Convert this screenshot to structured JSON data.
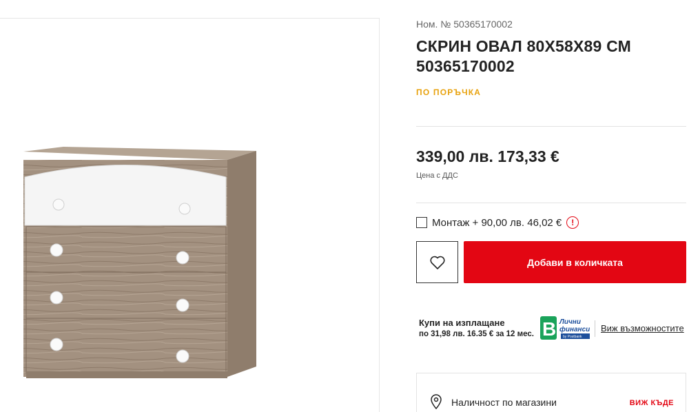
{
  "product": {
    "sku_label": "Ном. № 50365170002",
    "title": "СКРИН ОВАЛ 80Х58Х89 СМ 50365170002",
    "availability": "ПО ПОРЪЧКА",
    "price": "339,00 лв. 173,33 €",
    "vat_note": "Цена с ДДС",
    "image_alt": "Скрин Овал"
  },
  "assembly": {
    "label": "Монтаж + 90,00 лв. 46,02 €",
    "info_glyph": "!",
    "checked": false
  },
  "actions": {
    "wishlist_icon": "heart-icon",
    "add_to_cart": "Добави в количката"
  },
  "leasing": {
    "title": "Купи на изплащане",
    "terms": "по 31,98 лв. 16.35 € за 12 мес.",
    "logo_line1": "Лични",
    "logo_line2": "финанси",
    "logo_line3": "by Postbank",
    "link": "Виж възможностите"
  },
  "stores": {
    "icon": "location-pin-icon",
    "label": "Наличност по магазини",
    "link": "ВИЖ КЪДЕ"
  },
  "colors": {
    "accent_red": "#e30613",
    "status_orange": "#e8a20d",
    "logo_green": "#1aa35a",
    "logo_blue": "#1d4f9c"
  }
}
